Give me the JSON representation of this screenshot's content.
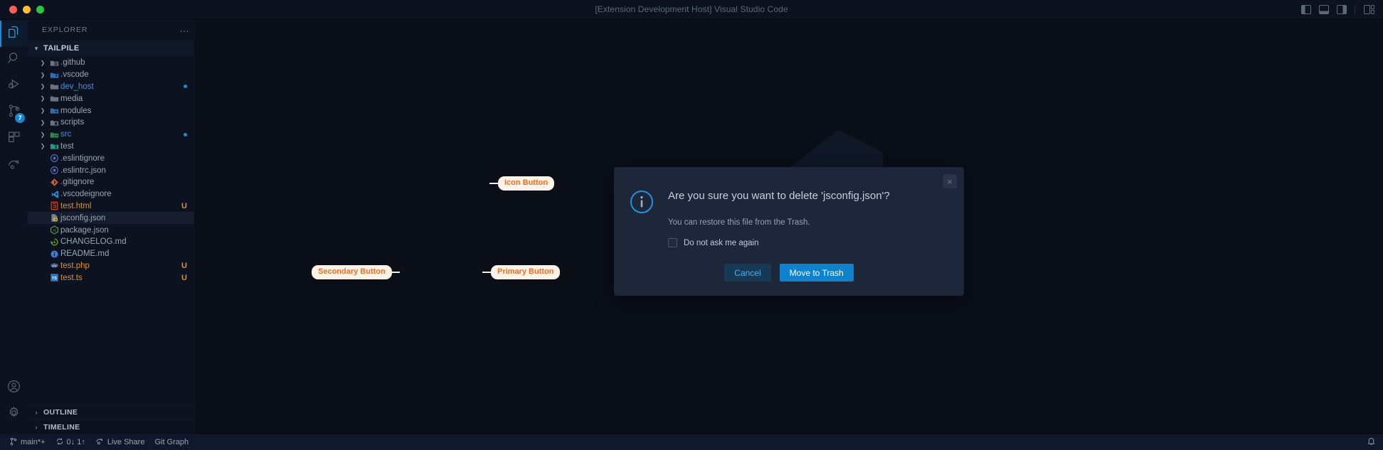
{
  "window": {
    "title": "[Extension Development Host] Visual Studio Code",
    "traffic_lights": [
      "close",
      "minimize",
      "zoom"
    ],
    "layout_icons": [
      "toggle-primary-sidebar-icon",
      "toggle-panel-icon",
      "toggle-secondary-sidebar-icon",
      "customize-layout-icon"
    ]
  },
  "activity_bar": {
    "items": [
      {
        "name": "explorer",
        "icon": "files-icon",
        "active": true,
        "badge": null
      },
      {
        "name": "search",
        "icon": "search-icon",
        "active": false,
        "badge": null
      },
      {
        "name": "run-and-debug",
        "icon": "run-debug-icon",
        "active": false,
        "badge": null
      },
      {
        "name": "source-control",
        "icon": "source-control-icon",
        "active": false,
        "badge": "7"
      },
      {
        "name": "extensions",
        "icon": "extensions-icon",
        "active": false,
        "badge": null
      },
      {
        "name": "live-share",
        "icon": "live-share-icon",
        "active": false,
        "badge": null
      }
    ],
    "bottom_items": [
      {
        "name": "accounts",
        "icon": "account-icon"
      },
      {
        "name": "manage",
        "icon": "gear-icon"
      }
    ]
  },
  "sidebar": {
    "header": {
      "title": "EXPLORER",
      "more_actions": "…"
    },
    "root_section": {
      "label": "TAILPILE",
      "expanded": true
    },
    "tree": [
      {
        "name": ".github",
        "type": "folder",
        "icon": "github-folder-icon",
        "color": "#9aa5b4",
        "status": ""
      },
      {
        "name": ".vscode",
        "type": "folder",
        "icon": "vscode-folder-icon",
        "color": "#9aa5b4",
        "status": ""
      },
      {
        "name": "dev_host",
        "type": "folder",
        "icon": "folder-icon",
        "color": "#4a8fe0",
        "status": "modified-dot"
      },
      {
        "name": "media",
        "type": "folder",
        "icon": "folder-icon",
        "color": "#9aa5b4",
        "status": ""
      },
      {
        "name": "modules",
        "type": "folder",
        "icon": "modules-folder-icon",
        "color": "#9aa5b4",
        "status": ""
      },
      {
        "name": "scripts",
        "type": "folder",
        "icon": "scripts-folder-icon",
        "color": "#9aa5b4",
        "status": ""
      },
      {
        "name": "src",
        "type": "folder",
        "icon": "src-folder-icon",
        "color": "#4a8fe0",
        "status": "modified-dot"
      },
      {
        "name": "test",
        "type": "folder",
        "icon": "test-folder-icon",
        "color": "#9aa5b4",
        "status": ""
      },
      {
        "name": ".eslintignore",
        "type": "file",
        "icon": "eslint-icon",
        "color": "#9aa5b4",
        "status": ""
      },
      {
        "name": ".eslintrc.json",
        "type": "file",
        "icon": "eslint-icon",
        "color": "#9aa5b4",
        "status": ""
      },
      {
        "name": ".gitignore",
        "type": "file",
        "icon": "git-icon",
        "color": "#9aa5b4",
        "status": ""
      },
      {
        "name": ".vscodeignore",
        "type": "file",
        "icon": "vscode-icon",
        "color": "#9aa5b4",
        "status": ""
      },
      {
        "name": "test.html",
        "type": "file",
        "icon": "html-icon",
        "color": "#d6913c",
        "status": "U"
      },
      {
        "name": "jsconfig.json",
        "type": "file",
        "icon": "jsconfig-icon",
        "color": "#9aa5b4",
        "status": "",
        "selected": true
      },
      {
        "name": "package.json",
        "type": "file",
        "icon": "nodejs-icon",
        "color": "#9aa5b4",
        "status": ""
      },
      {
        "name": "CHANGELOG.md",
        "type": "file",
        "icon": "changelog-icon",
        "color": "#9aa5b4",
        "status": ""
      },
      {
        "name": "README.md",
        "type": "file",
        "icon": "readme-icon",
        "color": "#9aa5b4",
        "status": ""
      },
      {
        "name": "test.php",
        "type": "file",
        "icon": "php-icon",
        "color": "#d6913c",
        "status": "U"
      },
      {
        "name": "test.ts",
        "type": "file",
        "icon": "typescript-icon",
        "color": "#d6913c",
        "status": "U"
      }
    ],
    "bottom_sections": [
      {
        "label": "OUTLINE",
        "expanded": false
      },
      {
        "label": "TIMELINE",
        "expanded": false
      }
    ]
  },
  "dialog": {
    "icon": "info-icon",
    "close_label": "×",
    "message": "Are you sure you want to delete 'jsconfig.json'?",
    "detail": "You can restore this file from the Trash.",
    "checkbox": {
      "label": "Do not ask me again",
      "checked": false
    },
    "buttons": [
      {
        "name": "cancel",
        "label": "Cancel",
        "style": "secondary"
      },
      {
        "name": "move-to-trash",
        "label": "Move to Trash",
        "style": "primary"
      }
    ]
  },
  "annotations": [
    {
      "id": "icon-button",
      "label": "Icon Button"
    },
    {
      "id": "secondary-button",
      "label": "Secondary Button"
    },
    {
      "id": "primary-button",
      "label": "Primary Button"
    }
  ],
  "status_bar": {
    "branch": "main*+",
    "sync": "0↓ 1↑",
    "live_share": "Live Share",
    "git_graph": "Git Graph",
    "notifications": "bell-icon"
  },
  "colors": {
    "accent_blue": "#0f82ce",
    "annotation_orange": "#f36d21",
    "annotation_bg": "#fdf3e9",
    "secondary_button_bg": "#163a55",
    "secondary_button_text": "#55aee6",
    "dialog_bg": "#1e2739",
    "sidebar_bg": "#0c1220",
    "editor_bg": "#0a0e17",
    "modified_dot": "#1f8ad1",
    "untracked_text": "#d6913c"
  }
}
